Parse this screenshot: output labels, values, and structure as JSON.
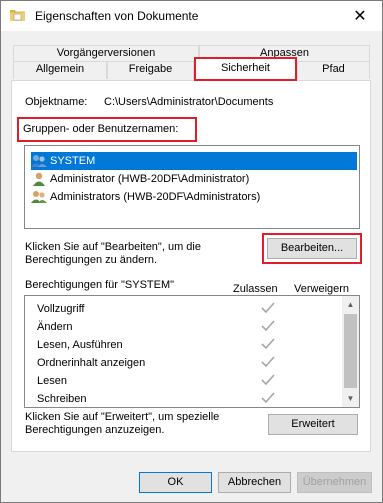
{
  "window": {
    "title": "Eigenschaften von Dokumente",
    "close": "✕"
  },
  "tabs": {
    "row1": [
      "Vorgängerversionen",
      "Anpassen"
    ],
    "row2": [
      "Allgemein",
      "Freigabe",
      "Sicherheit",
      "Pfad"
    ],
    "active": "Sicherheit"
  },
  "object": {
    "label": "Objektname:",
    "value": "C:\\Users\\Administrator\\Documents"
  },
  "groups": {
    "label": "Gruppen- oder Benutzernamen:",
    "items": [
      "SYSTEM",
      "Administrator (HWB-20DF\\Administrator)",
      "Administrators (HWB-20DF\\Administrators)"
    ]
  },
  "edit": {
    "text1": "Klicken Sie auf \"Bearbeiten\", um die",
    "text2": "Berechtigungen zu ändern.",
    "button": "Bearbeiten..."
  },
  "permissions": {
    "header": "Berechtigungen für \"SYSTEM\"",
    "allow": "Zulassen",
    "deny": "Verweigern",
    "rows": [
      "Vollzugriff",
      "Ändern",
      "Lesen, Ausführen",
      "Ordnerinhalt anzeigen",
      "Lesen",
      "Schreiben"
    ]
  },
  "advanced": {
    "text1": "Klicken Sie auf \"Erweitert\", um spezielle",
    "text2": "Berechtigungen anzuzeigen.",
    "button": "Erweitert"
  },
  "footer": {
    "ok": "OK",
    "cancel": "Abbrechen",
    "apply": "Übernehmen"
  },
  "colors": {
    "highlight": "#e11d2a",
    "selection": "#0078d7"
  }
}
